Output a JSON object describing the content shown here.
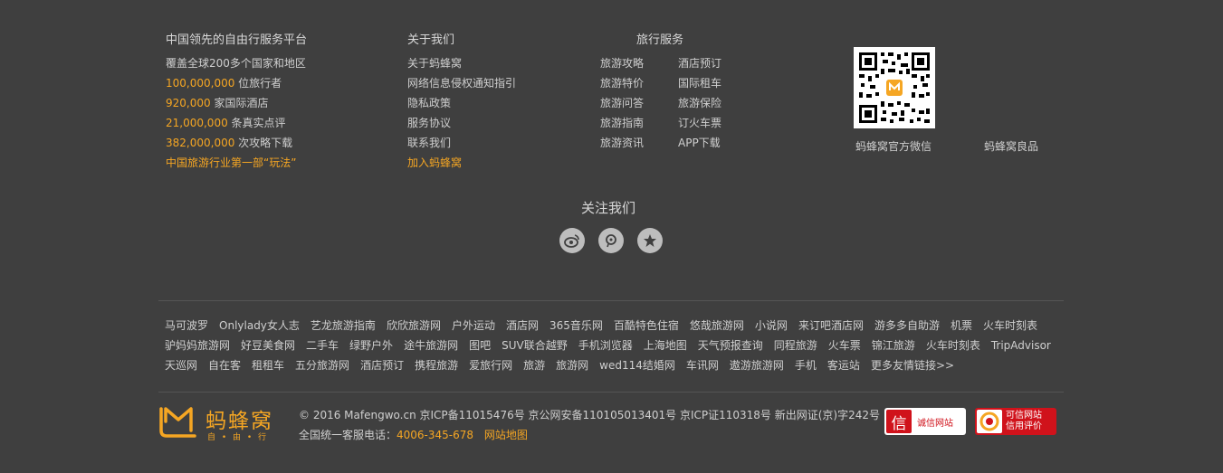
{
  "stats": {
    "title": "中国领先的自由行服务平台",
    "coverage": "覆盖全球200多个国家和地区",
    "lines": [
      {
        "num": "100,000,000",
        "text": " 位旅行者"
      },
      {
        "num": "920,000",
        "text": " 家国际酒店"
      },
      {
        "num": "21,000,000",
        "text": " 条真实点评"
      },
      {
        "num": "382,000,000",
        "text": " 次攻略下载"
      }
    ],
    "gameplay": "中国旅游行业第一部“玩法”"
  },
  "about": {
    "title": "关于我们",
    "links": [
      "关于蚂蜂窝",
      "网络信息侵权通知指引",
      "隐私政策",
      "服务协议",
      "联系我们"
    ],
    "join": "加入蚂蜂窝"
  },
  "services": {
    "title": "旅行服务",
    "links": [
      "旅游攻略",
      "酒店预订",
      "旅游特价",
      "国际租车",
      "旅游问答",
      "旅游保险",
      "旅游指南",
      "订火车票",
      "旅游资讯",
      "APP下载"
    ]
  },
  "qr": {
    "wechat_label": "蚂蜂窝官方微信",
    "shop_label": "蚂蜂窝良品"
  },
  "follow": {
    "title": "关注我们",
    "icons": [
      "weibo-icon",
      "qq-icon",
      "star-icon"
    ]
  },
  "friend_links": [
    [
      "马可波罗",
      "Onlylady女人志",
      "艺龙旅游指南",
      "欣欣旅游网",
      "户外运动",
      "酒店网",
      "365音乐网",
      "百酷特色住宿",
      "悠哉旅游网",
      "小说网",
      "来订吧酒店网",
      "游多多自助游",
      "机票",
      "火车时刻表"
    ],
    [
      "驴妈妈旅游网",
      "好豆美食网",
      "二手车",
      "绿野户外",
      "途牛旅游网",
      "图吧",
      "SUV联合越野",
      "手机浏览器",
      "上海地图",
      "天气预报查询",
      "同程旅游",
      "火车票",
      "锦江旅游",
      "火车时刻表",
      "TripAdvisor"
    ],
    [
      "天巡网",
      "自在客",
      "租租车",
      "五分旅游网",
      "酒店预订",
      "携程旅游",
      "爱旅行网",
      "旅游",
      "旅游网",
      "wed114结婚网",
      "车讯网",
      "遨游旅游网",
      "手机",
      "客运站",
      "更多友情链接>>"
    ]
  ],
  "brand": {
    "name": "蚂蜂窝",
    "tagline": "自 • 由 • 行",
    "color": "#f5a623"
  },
  "footer": {
    "copyright": "© 2016 Mafengwo.cn 京ICP备11015476号 京公网安备110105013401号 京ICP证110318号 新出网证(京)字242号",
    "hotline_label": "全国统一客服电话：",
    "hotline": "4006-345-678",
    "sitemap": "网站地图"
  },
  "badges": {
    "chengxin": "诚信网站",
    "kexin_line1": "可信网站",
    "kexin_line2": "信用评价"
  }
}
